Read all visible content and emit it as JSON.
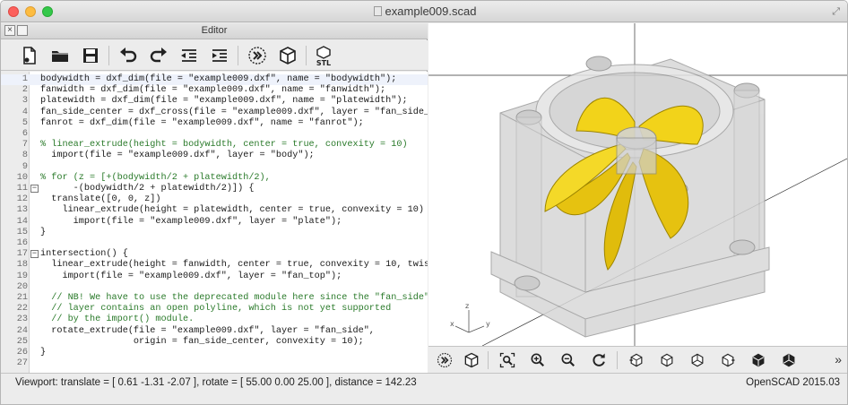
{
  "window": {
    "title": "example009.scad"
  },
  "editor": {
    "header_title": "Editor",
    "toolbar": [
      {
        "name": "new-file-icon"
      },
      {
        "name": "open-folder-icon"
      },
      {
        "name": "save-icon"
      },
      {
        "name": "undo-icon"
      },
      {
        "name": "redo-icon"
      },
      {
        "name": "unindent-icon"
      },
      {
        "name": "indent-icon"
      },
      {
        "name": "preview-icon"
      },
      {
        "name": "render-icon"
      },
      {
        "name": "export-stl-icon",
        "label": "STL"
      }
    ],
    "lines": [
      {
        "n": "1",
        "text": "bodywidth = dxf_dim(file = \"example009.dxf\", name = \"bodywidth\");"
      },
      {
        "n": "2",
        "text": "fanwidth = dxf_dim(file = \"example009.dxf\", name = \"fanwidth\");"
      },
      {
        "n": "3",
        "text": "platewidth = dxf_dim(file = \"example009.dxf\", name = \"platewidth\");"
      },
      {
        "n": "4",
        "text": "fan_side_center = dxf_cross(file = \"example009.dxf\", layer = \"fan_side_center\");"
      },
      {
        "n": "5",
        "text": "fanrot = dxf_dim(file = \"example009.dxf\", name = \"fanrot\");"
      },
      {
        "n": "6",
        "text": ""
      },
      {
        "n": "7",
        "text": "% linear_extrude(height = bodywidth, center = true, convexity = 10)"
      },
      {
        "n": "8",
        "text": "  import(file = \"example009.dxf\", layer = \"body\");"
      },
      {
        "n": "9",
        "text": ""
      },
      {
        "n": "10",
        "text": "% for (z = [+(bodywidth/2 + platewidth/2),"
      },
      {
        "n": "11",
        "text": "      -(bodywidth/2 + platewidth/2)]) {"
      },
      {
        "n": "12",
        "text": "  translate([0, 0, z])"
      },
      {
        "n": "13",
        "text": "    linear_extrude(height = platewidth, center = true, convexity = 10)"
      },
      {
        "n": "14",
        "text": "      import(file = \"example009.dxf\", layer = \"plate\");"
      },
      {
        "n": "15",
        "text": "}"
      },
      {
        "n": "16",
        "text": ""
      },
      {
        "n": "17",
        "text": "intersection() {"
      },
      {
        "n": "18",
        "text": "  linear_extrude(height = fanwidth, center = true, convexity = 10, twist = -fanrot)"
      },
      {
        "n": "19",
        "text": "    import(file = \"example009.dxf\", layer = \"fan_top\");"
      },
      {
        "n": "20",
        "text": ""
      },
      {
        "n": "21",
        "text": "  // NB! We have to use the deprecated module here since the \"fan_side\""
      },
      {
        "n": "22",
        "text": "  // layer contains an open polyline, which is not yet supported"
      },
      {
        "n": "23",
        "text": "  // by the import() module."
      },
      {
        "n": "24",
        "text": "  rotate_extrude(file = \"example009.dxf\", layer = \"fan_side\","
      },
      {
        "n": "25",
        "text": "                 origin = fan_side_center, convexity = 10);"
      },
      {
        "n": "26",
        "text": "}"
      },
      {
        "n": "27",
        "text": ""
      }
    ]
  },
  "view3d": {
    "axis_labels": {
      "x": "x",
      "y": "y",
      "z": "z"
    },
    "toolbar": [
      {
        "name": "preview-icon"
      },
      {
        "name": "render-icon"
      },
      {
        "name": "view-all-icon"
      },
      {
        "name": "zoom-in-icon"
      },
      {
        "name": "zoom-out-icon"
      },
      {
        "name": "reset-view-icon"
      },
      {
        "name": "view-right-icon"
      },
      {
        "name": "view-top-icon"
      },
      {
        "name": "view-bottom-icon"
      },
      {
        "name": "view-left-icon"
      },
      {
        "name": "view-front-icon"
      },
      {
        "name": "view-back-icon"
      }
    ],
    "more_label": "»",
    "colors": {
      "fan": "#f2d31a",
      "body": "#c8c8c8",
      "axis": "#333333"
    }
  },
  "status": {
    "viewport": "Viewport: translate = [ 0.61 -1.31 -2.07 ], rotate = [ 55.00 0.00 25.00 ], distance = 142.23",
    "version": "OpenSCAD 2015.03"
  }
}
